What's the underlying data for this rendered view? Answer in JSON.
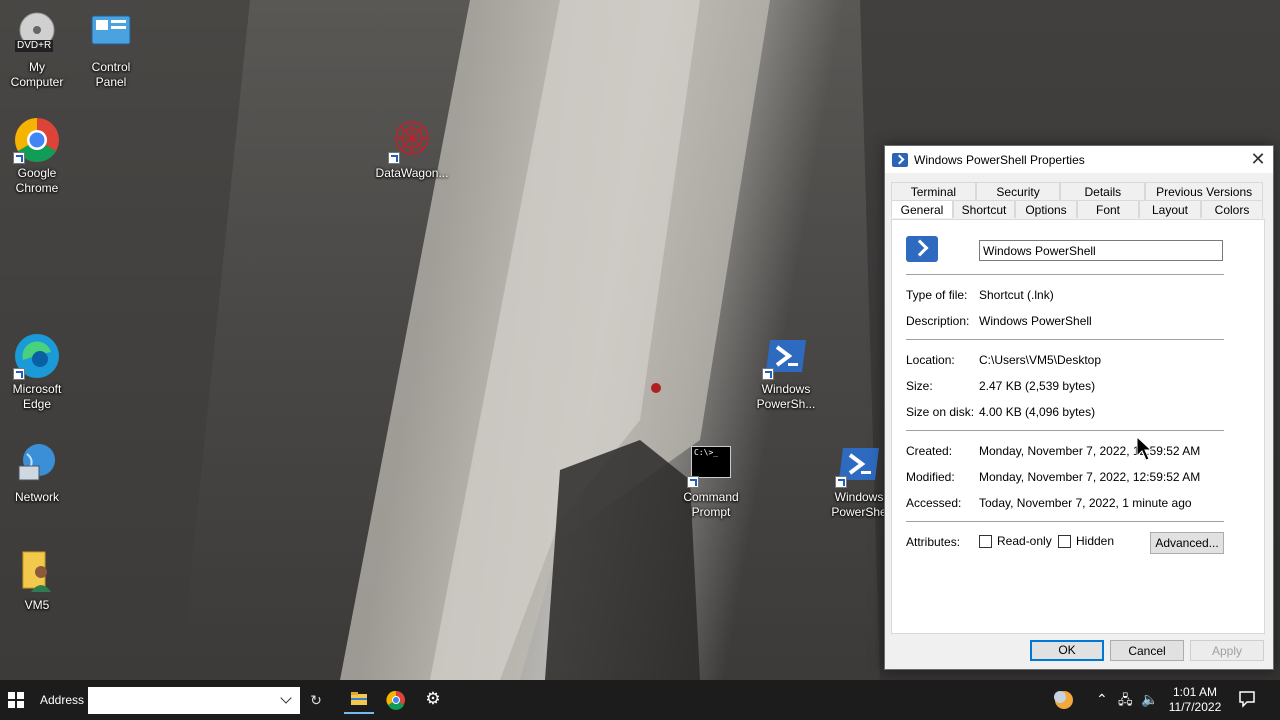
{
  "desktop": {
    "icons": [
      {
        "name": "my-computer-icon",
        "label_line1": "My",
        "label_line2": "Computer",
        "badge": "DVD+R"
      },
      {
        "name": "control-panel-icon",
        "label_line1": "Control",
        "label_line2": "Panel"
      },
      {
        "name": "google-chrome-icon",
        "label_line1": "Google",
        "label_line2": "Chrome"
      },
      {
        "name": "datawagon-icon",
        "label_line1": "DataWagon...",
        "label_line2": ""
      },
      {
        "name": "microsoft-edge-icon",
        "label_line1": "Microsoft",
        "label_line2": "Edge"
      },
      {
        "name": "windows-powershell-icon",
        "label_line1": "Windows",
        "label_line2": "PowerSh..."
      },
      {
        "name": "network-icon",
        "label_line1": "Network",
        "label_line2": ""
      },
      {
        "name": "command-prompt-icon",
        "label_line1": "Command",
        "label_line2": "Prompt",
        "screen_text": "C:\\>_"
      },
      {
        "name": "windows-powershell-icon-2",
        "label_line1": "Windows",
        "label_line2": "PowerShe"
      },
      {
        "name": "vm5-user-folder-icon",
        "label_line1": "VM5",
        "label_line2": ""
      }
    ]
  },
  "dialog": {
    "title": "Windows PowerShell Properties",
    "tabs_row1": [
      "Terminal",
      "Security",
      "Details",
      "Previous Versions"
    ],
    "tabs_row2": [
      "General",
      "Shortcut",
      "Options",
      "Font",
      "Layout",
      "Colors"
    ],
    "active_tab": "General",
    "name_value": "Windows PowerShell",
    "fields": {
      "type_label": "Type of file:",
      "type_value": "Shortcut (.lnk)",
      "desc_label": "Description:",
      "desc_value": "Windows PowerShell",
      "loc_label": "Location:",
      "loc_value": "C:\\Users\\VM5\\Desktop",
      "size_label": "Size:",
      "size_value": "2.47 KB (2,539 bytes)",
      "disk_label": "Size on disk:",
      "disk_value": "4.00 KB (4,096 bytes)",
      "created_label": "Created:",
      "created_value": "Monday, November 7, 2022, 12:59:52 AM",
      "modified_label": "Modified:",
      "modified_value": "Monday, November 7, 2022, 12:59:52 AM",
      "accessed_label": "Accessed:",
      "accessed_value": "Today, November 7, 2022, 1 minute ago",
      "attr_label": "Attributes:",
      "readonly_label": "Read-only",
      "hidden_label": "Hidden",
      "readonly_checked": false,
      "hidden_checked": false
    },
    "advanced_label": "Advanced...",
    "ok_label": "OK",
    "cancel_label": "Cancel",
    "apply_label": "Apply"
  },
  "taskbar": {
    "address_label": "Address",
    "address_value": "",
    "time": "1:01 AM",
    "date": "11/7/2022"
  },
  "colors": {
    "accent": "#0078d7",
    "taskbar": "#1c1c1c",
    "powershell": "#2d6ac0"
  }
}
